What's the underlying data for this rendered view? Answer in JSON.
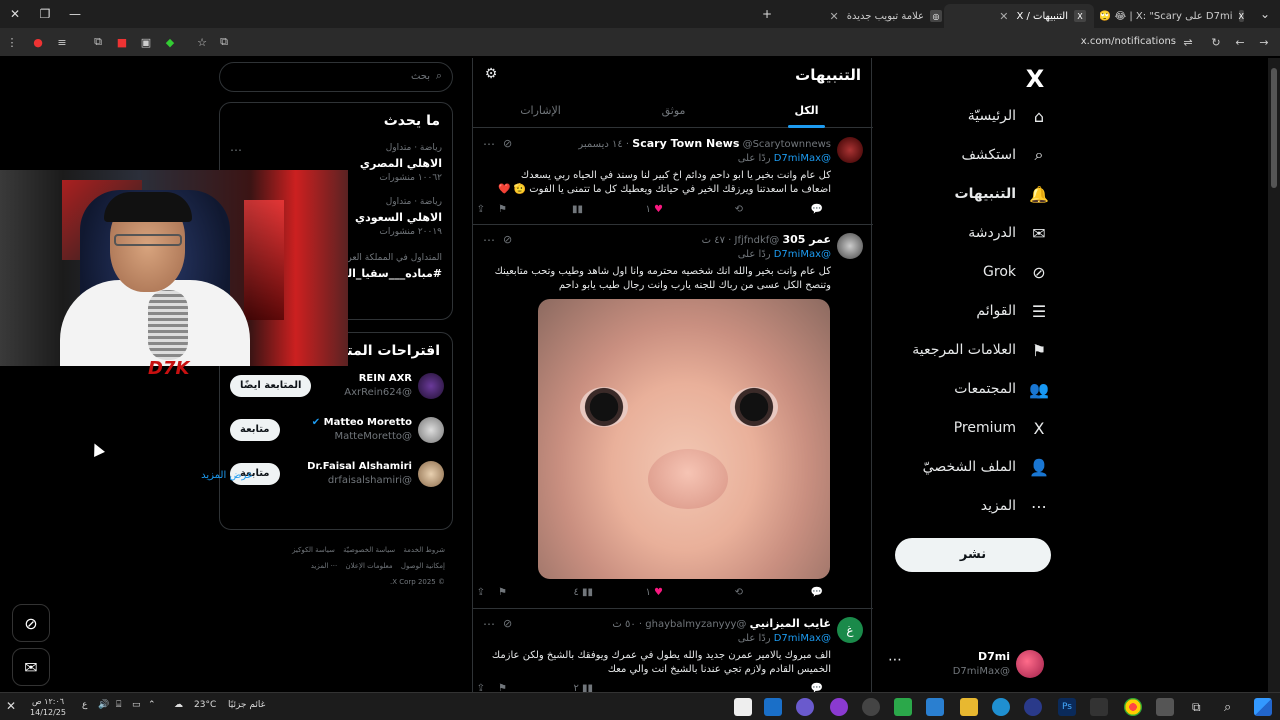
{
  "browser": {
    "tabs": [
      {
        "title": "D7mi على X: \"Scary | 😂 🙄 خير",
        "active": false
      },
      {
        "title": "التنبيهات / X",
        "active": true
      },
      {
        "title": "علامة تبويب جديدة",
        "active": false
      }
    ],
    "url": "x.com/notifications"
  },
  "nav": {
    "logo": "X",
    "items": [
      {
        "label": "الرئيسيّة",
        "icon": "home-icon",
        "glyph": "⌂"
      },
      {
        "label": "استكشف",
        "icon": "search-icon",
        "glyph": "⌕"
      },
      {
        "label": "التنبيهات",
        "icon": "bell-icon",
        "glyph": "🔔"
      },
      {
        "label": "الدردشة",
        "icon": "mail-icon",
        "glyph": "✉"
      },
      {
        "label": "Grok",
        "icon": "grok-icon",
        "glyph": "⊘"
      },
      {
        "label": "القوائم",
        "icon": "list-icon",
        "glyph": "☰"
      },
      {
        "label": "العلامات المرجعية",
        "icon": "bookmark-icon",
        "glyph": "⚑"
      },
      {
        "label": "المجتمعات",
        "icon": "communities-icon",
        "glyph": "👥"
      },
      {
        "label": "Premium",
        "icon": "x-premium-icon",
        "glyph": "X"
      },
      {
        "label": "الملف الشخصيّ",
        "icon": "profile-icon",
        "glyph": "👤"
      },
      {
        "label": "المزيد",
        "icon": "more-icon",
        "glyph": "⋯"
      }
    ],
    "post_label": "نشر",
    "account": {
      "name": "D7mi",
      "handle": "@D7miMax"
    }
  },
  "main": {
    "title": "التنبيهات",
    "tabs": [
      "الكل",
      "موثق",
      "الإشارات"
    ],
    "tweets": [
      {
        "name": "Scary Town News",
        "handle": "@Scarytownnews",
        "time": "١٤ ديسمبر",
        "reply_prefix": "ردًا على",
        "reply_to": "@D7miMax",
        "text": "كل عام وانت بخير يا ابو داحم ودائم اخ كبير لنا وسند في الحياه ربي يسعدك اضعاف ما اسعدتنا ويرزقك الخير في حياتك ويعطيك كل ما تتمنى يا الفوت 🫡 ❤️",
        "likes": "١",
        "views": ""
      },
      {
        "name": "عمر 305",
        "handle": "@Jfjfndkf",
        "time": "٤٧ ث",
        "reply_prefix": "ردًا على",
        "reply_to": "@D7miMax",
        "text": "كل عام وانت بخير والله انك شخصيه محترمه وانا اول شاهد وطيب وتحب متابعينك وتنصح الكل عسى من رباك للجنه يارب وانت رجال طيب يابو داحم",
        "likes": "١",
        "views": "٤"
      },
      {
        "name": "غايب الميزانيي",
        "handle": "@ghaybalmyzanyyy",
        "time": "٥٠ ث",
        "reply_prefix": "ردًا على",
        "reply_to": "@D7miMax",
        "text": "الف مبروك يالامير عمرن جديد والله يطول في عمرك ويوفقك بالشيخ ولكن عازمك الخميس القادم ولازم تجي عندنا بالشيخ انت والي معك",
        "likes": "",
        "views": "٢"
      }
    ]
  },
  "side": {
    "search_placeholder": "بحث",
    "trends_title": "ما يحدث",
    "trends": [
      {
        "category": "رياضة · متداول",
        "name": "الاهلي المصري",
        "count": "١٠٠٦٢ منشورات"
      },
      {
        "category": "رياضة · متداول",
        "name": "الاهلي السعودي",
        "count": "٢٠٠١٩ منشورات"
      },
      {
        "category": "المتداول في المملكة العربية",
        "name": "#مباده___سقيا_الما",
        "count": ""
      }
    ],
    "who_title": "اقتراحات المتابعة",
    "who": [
      {
        "name": "REIN AXR",
        "handle": "@AxrRein624",
        "button": "المتابعة ايضًا"
      },
      {
        "name": "Matteo Moretto",
        "handle": "@MatteMoretto",
        "button": "متابعة"
      },
      {
        "name": "Dr.Faisal Alshamiri",
        "handle": "@drfaisalshamiri",
        "button": "متابعة"
      }
    ],
    "show_more": "عرض المزيد",
    "footer": [
      "شروط الخدمة",
      "سياسة الخصوصيّة",
      "سياسة الكوكيز",
      "إمكانية الوصول",
      "معلومات الإعلان",
      "··· المزيد",
      "© 2025 X Corp."
    ]
  },
  "overlay": {
    "cam_logo": "D7K"
  },
  "taskbar": {
    "weather": "غائم جزئيًا",
    "temp": "23°C",
    "time": "١٢:٠٦ ص",
    "date": "14/12/25"
  }
}
